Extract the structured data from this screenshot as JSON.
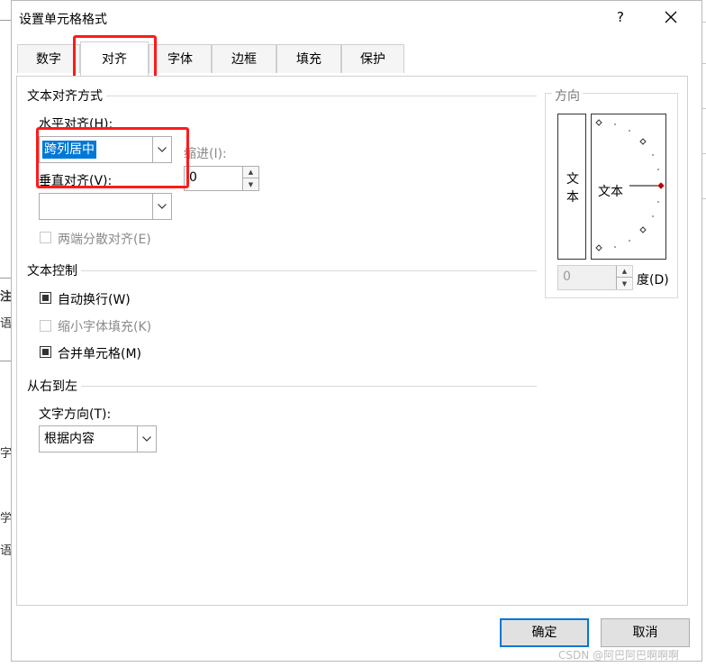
{
  "dialog": {
    "title": "设置单元格格式",
    "help": "?",
    "close": "✕"
  },
  "tabs": [
    {
      "label": "数字"
    },
    {
      "label": "对齐",
      "active": true
    },
    {
      "label": "字体"
    },
    {
      "label": "边框"
    },
    {
      "label": "填充"
    },
    {
      "label": "保护"
    }
  ],
  "text_alignment": {
    "group_title": "文本对齐方式",
    "horizontal_label": "水平对齐(H):",
    "horizontal_value": "跨列居中",
    "indent_label": "缩进(I):",
    "indent_value": "0",
    "vertical_label": "垂直对齐(V):",
    "vertical_value": "",
    "justify_distributed_label": "两端分散对齐(E)"
  },
  "text_control": {
    "group_title": "文本控制",
    "wrap_text_label": "自动换行(W)",
    "wrap_text_checked": true,
    "shrink_to_fit_label": "缩小字体填充(K)",
    "shrink_to_fit_checked": false,
    "merge_cells_label": "合并单元格(M)",
    "merge_cells_checked": true
  },
  "rtl": {
    "group_title": "从右到左",
    "direction_label": "文字方向(T):",
    "direction_value": "根据内容"
  },
  "orientation": {
    "group_title": "方向",
    "vertical_text": "文本",
    "dial_text": "文本",
    "degree_value": "0",
    "degree_label": "度(D)"
  },
  "buttons": {
    "ok": "确定",
    "cancel": "取消"
  },
  "watermark": "CSDN @阿巴阿巴啊啊啊",
  "background_fragments": [
    "注",
    "语",
    "字",
    "学",
    "语"
  ],
  "colors": {
    "highlight_red": "#ff1a1a",
    "selection_blue": "#0078d7",
    "dial_marker": "#c00000"
  }
}
